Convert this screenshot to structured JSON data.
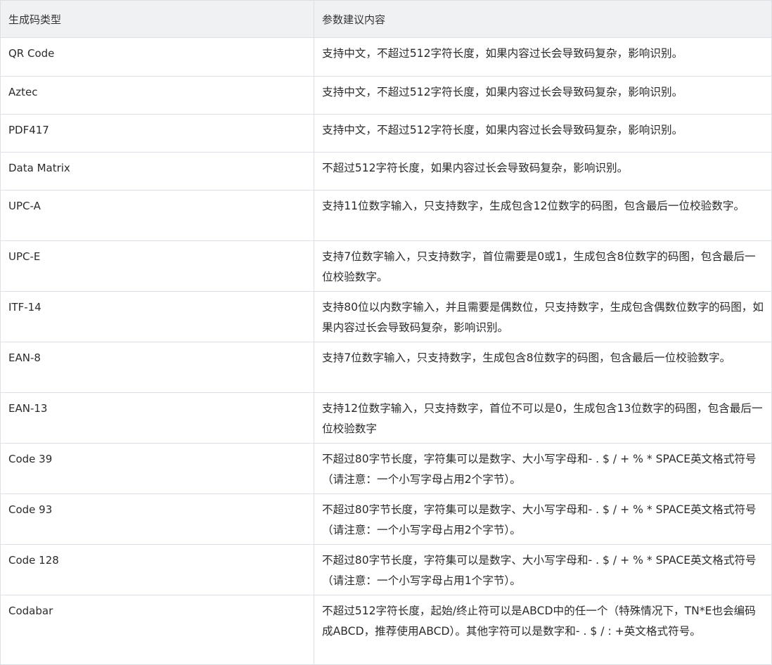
{
  "headers": {
    "type": "生成码类型",
    "advice": "参数建议内容"
  },
  "rows": [
    {
      "type": "QR Code",
      "advice": "支持中文，不超过512字符长度，如果内容过长会导致码复杂，影响识别。"
    },
    {
      "type": "Aztec",
      "advice": "支持中文，不超过512字符长度，如果内容过长会导致码复杂，影响识别。"
    },
    {
      "type": "PDF417",
      "advice": "支持中文，不超过512字符长度，如果内容过长会导致码复杂，影响识别。"
    },
    {
      "type": "Data Matrix",
      "advice": "不超过512字符长度，如果内容过长会导致码复杂，影响识别。"
    },
    {
      "type": "UPC-A",
      "advice": "支持11位数字输入，只支持数字，生成包含12位数字的码图，包含最后一位校验数字。"
    },
    {
      "type": "UPC-E",
      "advice": "支持7位数字输入，只支持数字，首位需要是0或1，生成包含8位数字的码图，包含最后一位校验数字。"
    },
    {
      "type": "ITF-14",
      "advice": "支持80位以内数字输入，并且需要是偶数位，只支持数字，生成包含偶数位数字的码图，如果内容过长会导致码复杂，影响识别。"
    },
    {
      "type": "EAN-8",
      "advice": "支持7位数字输入，只支持数字，生成包含8位数字的码图，包含最后一位校验数字。"
    },
    {
      "type": "EAN-13",
      "advice": "支持12位数字输入，只支持数字，首位不可以是0，生成包含13位数字的码图，包含最后一位校验数字"
    },
    {
      "type": "Code 39",
      "advice": "不超过80字节长度，字符集可以是数字、大小写字母和- . $ / + % * SPACE英文格式符号（请注意：一个小写字母占用2个字节）。"
    },
    {
      "type": "Code 93",
      "advice": "不超过80字节长度，字符集可以是数字、大小写字母和- . $ / + % * SPACE英文格式符号（请注意：一个小写字母占用2个字节）。"
    },
    {
      "type": "Code 128",
      "advice": "不超过80字节长度，字符集可以是数字、大小写字母和- . $ / + % * SPACE英文格式符号（请注意：一个小写字母占用1个字节）。"
    },
    {
      "type": "Codabar",
      "advice": "不超过512字符长度，起始/终止符可以是ABCD中的任一个（特殊情况下，TN*E也会编码成ABCD，推荐使用ABCD）。其他字符可以是数字和- . $ / : +英文格式符号。"
    }
  ]
}
